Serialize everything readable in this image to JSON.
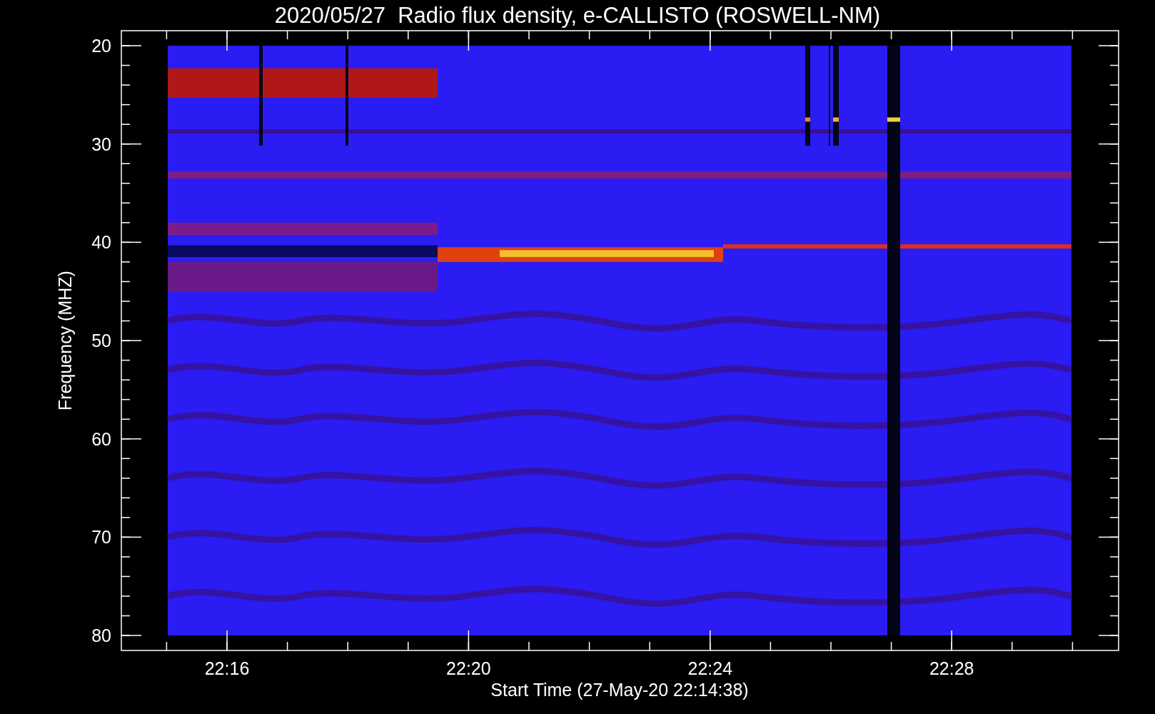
{
  "title": "2020/05/27  Radio flux density, e-CALLISTO (ROSWELL-NM)",
  "y_axis": {
    "label": "Frequency (MHZ)",
    "ticks": [
      "20",
      "30",
      "40",
      "50",
      "60",
      "70",
      "80"
    ]
  },
  "x_axis": {
    "label": "Start Time (27-May-20 22:14:38)",
    "ticks": [
      "22:16",
      "22:20",
      "22:24",
      "22:28"
    ]
  }
}
